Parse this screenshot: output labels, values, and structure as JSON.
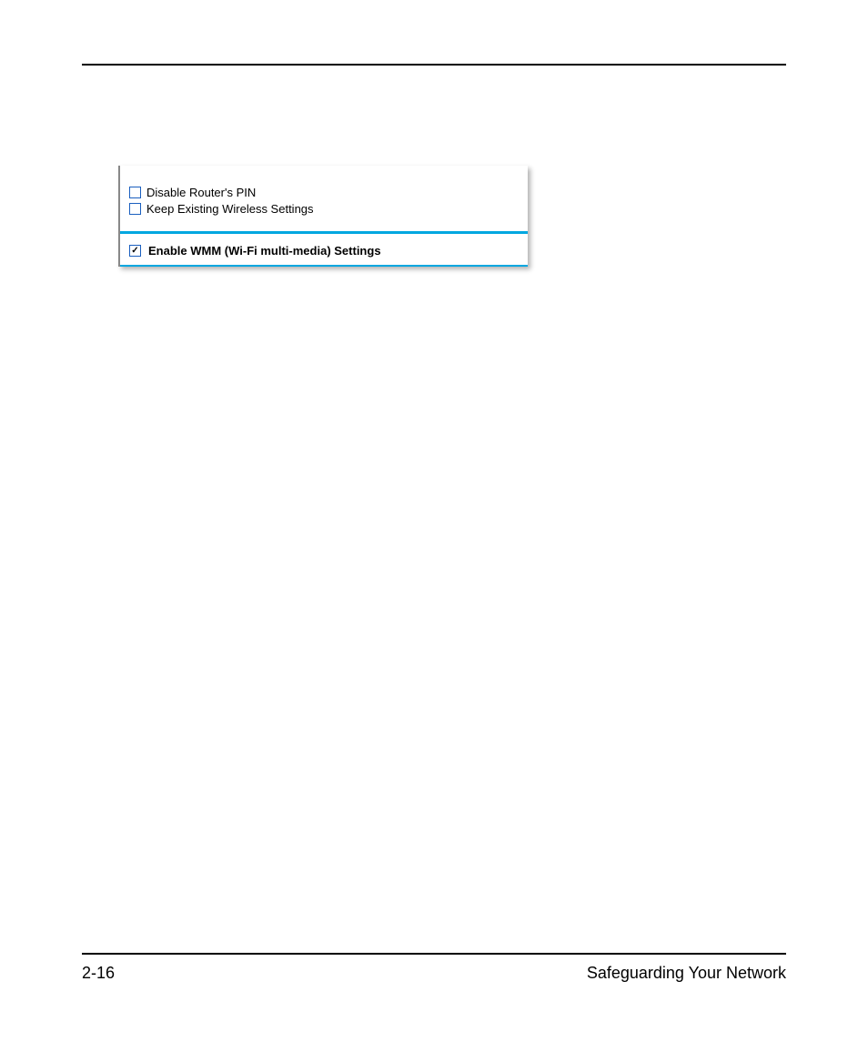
{
  "footer": {
    "page_number": "2-16",
    "section_title": "Safeguarding Your Network"
  },
  "panel": {
    "cutoff_left": "",
    "cutoff_right": "",
    "options": [
      {
        "label": "Disable Router's PIN",
        "checked": false
      },
      {
        "label": "Keep Existing Wireless Settings",
        "checked": false
      }
    ],
    "wmm": {
      "label": "Enable WMM (Wi-Fi multi-media) Settings",
      "checked": true
    }
  }
}
